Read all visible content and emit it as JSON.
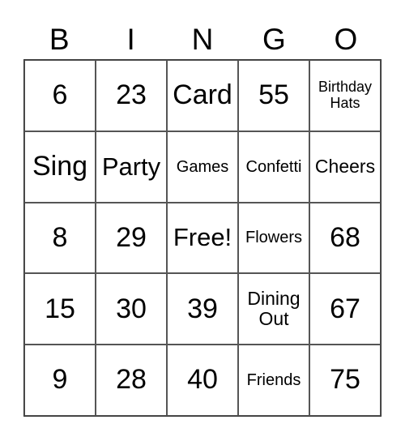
{
  "header": {
    "letters": [
      "B",
      "I",
      "N",
      "G",
      "O"
    ]
  },
  "board": {
    "rows": [
      [
        {
          "text": "6",
          "size": "xl"
        },
        {
          "text": "23",
          "size": "xl"
        },
        {
          "text": "Card",
          "size": "xl"
        },
        {
          "text": "55",
          "size": "xl"
        },
        {
          "text": "Birthday Hats",
          "size": "xs"
        }
      ],
      [
        {
          "text": "Sing",
          "size": "xl"
        },
        {
          "text": "Party",
          "size": "lg"
        },
        {
          "text": "Games",
          "size": "sm"
        },
        {
          "text": "Confetti",
          "size": "sm"
        },
        {
          "text": "Cheers",
          "size": "md"
        }
      ],
      [
        {
          "text": "8",
          "size": "xl"
        },
        {
          "text": "29",
          "size": "xl"
        },
        {
          "text": "Free!",
          "size": "lg"
        },
        {
          "text": "Flowers",
          "size": "sm"
        },
        {
          "text": "68",
          "size": "xl"
        }
      ],
      [
        {
          "text": "15",
          "size": "xl"
        },
        {
          "text": "30",
          "size": "xl"
        },
        {
          "text": "39",
          "size": "xl"
        },
        {
          "text": "Dining Out",
          "size": "md"
        },
        {
          "text": "67",
          "size": "xl"
        }
      ],
      [
        {
          "text": "9",
          "size": "xl"
        },
        {
          "text": "28",
          "size": "xl"
        },
        {
          "text": "40",
          "size": "xl"
        },
        {
          "text": "Friends",
          "size": "sm"
        },
        {
          "text": "75",
          "size": "xl"
        }
      ]
    ]
  }
}
